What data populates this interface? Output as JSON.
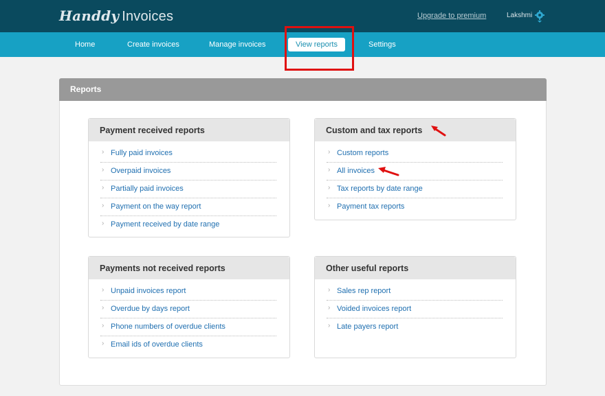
{
  "header": {
    "logo_script": "Handdy",
    "logo_plain": "Invoices",
    "upgrade_link": "Upgrade to premium",
    "user_name": "Lakshmi",
    "settings_icon": "gear-icon"
  },
  "nav": {
    "items": [
      {
        "label": "Home"
      },
      {
        "label": "Create invoices"
      },
      {
        "label": "Manage invoices"
      },
      {
        "label": "View reports",
        "active": true
      },
      {
        "label": "Settings"
      }
    ]
  },
  "panel": {
    "title": "Reports"
  },
  "cards": [
    {
      "title": "Payment received reports",
      "links": [
        "Fully paid invoices",
        "Overpaid invoices",
        "Partially paid invoices",
        "Payment on the way report",
        "Payment received by date range"
      ]
    },
    {
      "title": "Custom and tax reports",
      "links": [
        "Custom reports",
        "All invoices",
        "Tax reports by date range",
        "Payment tax reports"
      ]
    },
    {
      "title": "Payments not received reports",
      "links": [
        "Unpaid invoices report",
        "Overdue by days report",
        "Phone numbers of overdue clients",
        "Email ids of overdue clients"
      ]
    },
    {
      "title": "Other useful reports",
      "links": [
        "Sales rep report",
        "Voided invoices report",
        "Late payers report"
      ]
    }
  ],
  "colors": {
    "topbar": "#0a4a5e",
    "navbar": "#17a1c4",
    "link": "#1f6fb0",
    "annotation": "#e01010"
  }
}
